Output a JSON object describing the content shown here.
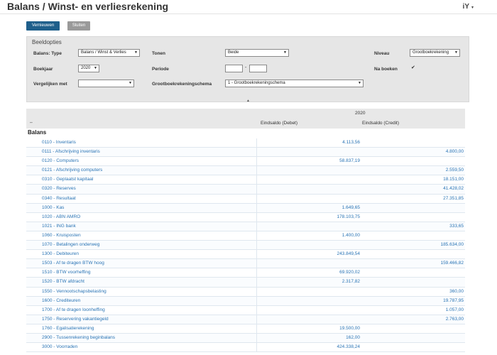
{
  "page": {
    "title": "Balans / Winst- en verliesrekening",
    "lang_label": "iY",
    "lang_caret": "▾"
  },
  "toolbar": {
    "refresh_label": "Vernieuwen",
    "close_label": "Sluiten"
  },
  "options": {
    "title": "Beeldopties",
    "balans_type": {
      "label": "Balans: Type",
      "value": "Balans / Winst & Verlies"
    },
    "tonen": {
      "label": "Tonen",
      "value": "Beide"
    },
    "niveau": {
      "label": "Niveau",
      "value": "Grootboekrekening"
    },
    "boekjaar": {
      "label": "Boekjaar",
      "value": "2020"
    },
    "periode": {
      "label": "Periode",
      "from": "",
      "to": "",
      "separator": "-"
    },
    "na_boeken": {
      "label": "Na boeken",
      "checked": true,
      "check_glyph": "✔"
    },
    "vergelijken": {
      "label": "Vergelijken met",
      "value": ""
    },
    "schema": {
      "label": "Grootboekrekeningschema",
      "value": "1 - Grootboekrekeningschema"
    },
    "collapse_glyph": "▲"
  },
  "grid": {
    "year": "2020",
    "expand_icon": "⇔",
    "col_debit": "Eindsaldo (Debet)",
    "col_credit": "Eindsaldo (Credit)",
    "section": "Balans",
    "rows": [
      {
        "account": "0110 - Inventaris",
        "debit": "4.113,56",
        "credit": ""
      },
      {
        "account": "0111 - Afschrijving inventaris",
        "debit": "",
        "credit": "4.800,00"
      },
      {
        "account": "0120 - Computers",
        "debit": "58.837,19",
        "credit": ""
      },
      {
        "account": "0121 - Afschrijving computers",
        "debit": "",
        "credit": "2.559,50"
      },
      {
        "account": "0310 - Geplaatst kapitaal",
        "debit": "",
        "credit": "18.151,00"
      },
      {
        "account": "0320 - Reserves",
        "debit": "",
        "credit": "41.428,02"
      },
      {
        "account": "0340 - Resultaat",
        "debit": "",
        "credit": "27.351,85"
      },
      {
        "account": "1000 - Kas",
        "debit": "1.649,65",
        "credit": ""
      },
      {
        "account": "1020 - ABN AMRO",
        "debit": "178.103,75",
        "credit": ""
      },
      {
        "account": "1021 - ING bank",
        "debit": "",
        "credit": "333,65"
      },
      {
        "account": "1060 - Kruisposten",
        "debit": "1.400,00",
        "credit": ""
      },
      {
        "account": "1070 - Betalingen onderweg",
        "debit": "",
        "credit": "185.634,00"
      },
      {
        "account": "1300 - Debiteuren",
        "debit": "243.849,54",
        "credit": ""
      },
      {
        "account": "1503 - Af te dragen BTW hoog",
        "debit": "",
        "credit": "159.466,82"
      },
      {
        "account": "1510 - BTW voorheffing",
        "debit": "69.920,02",
        "credit": ""
      },
      {
        "account": "1520 - BTW afdracht",
        "debit": "2.317,82",
        "credit": ""
      },
      {
        "account": "1550 - Vennootschapsbelasting",
        "debit": "",
        "credit": "360,00"
      },
      {
        "account": "1600 - Crediteuren",
        "debit": "",
        "credit": "19.787,95"
      },
      {
        "account": "1700 - Af te dragen loonheffing",
        "debit": "",
        "credit": "1.057,00"
      },
      {
        "account": "1750 - Reservering vakantiegeld",
        "debit": "",
        "credit": "2.763,00"
      },
      {
        "account": "1760 - Egalisatierekening",
        "debit": "19.500,00",
        "credit": ""
      },
      {
        "account": "2900 - Tussenrekening beginbalans",
        "debit": "162,00",
        "credit": ""
      },
      {
        "account": "3000 - Voorraden",
        "debit": "424.338,24",
        "credit": ""
      }
    ]
  }
}
